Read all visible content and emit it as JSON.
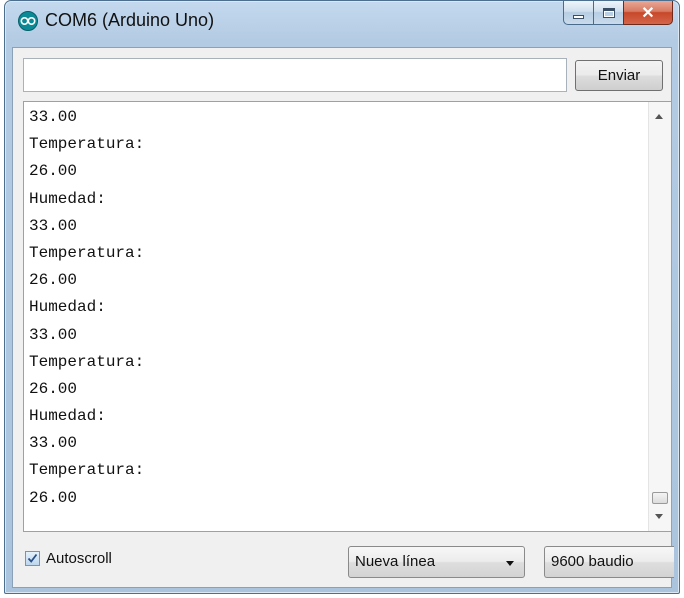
{
  "window": {
    "title": "COM6 (Arduino Uno)",
    "icon": "arduino-icon",
    "controls": [
      "minimize-icon",
      "maximize-icon",
      "close-icon"
    ]
  },
  "send": {
    "input_value": "",
    "button_label": "Enviar"
  },
  "console": {
    "lines": [
      "33.00",
      "Temperatura:",
      "26.00",
      "Humedad:",
      "33.00",
      "Temperatura:",
      "26.00",
      "Humedad:",
      "33.00",
      "Temperatura:",
      "26.00",
      "Humedad:",
      "33.00",
      "Temperatura:",
      "26.00"
    ]
  },
  "footer": {
    "autoscroll_label": "Autoscroll",
    "autoscroll_checked": true,
    "line_ending": "Nueva línea",
    "baud_rate": "9600 baudio"
  },
  "colors": {
    "frame": "#b3cbe3",
    "close_button": "#c7482b",
    "arduino_teal": "#0b8a96"
  }
}
